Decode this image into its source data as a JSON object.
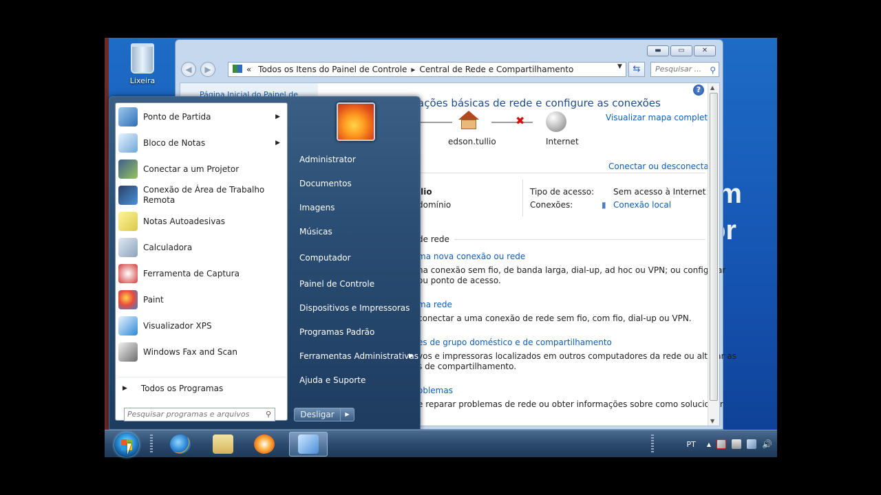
{
  "desktop": {
    "recycle_label": "Lixeira",
    "bg_text_1": "om",
    "bg_text_2": "or"
  },
  "window": {
    "controls": [
      "minimize-icon",
      "maximize-icon",
      "close-icon"
    ],
    "back_icon": "back-arrow-icon",
    "forward_icon": "forward-arrow-icon",
    "breadcrumb": {
      "root_icon": "control-panel-icon",
      "overflow": "«",
      "items": [
        "Todos os Itens do Painel de Controle",
        "Central de Rede e Compartilhamento"
      ]
    },
    "search_placeholder": "Pesquisar ...",
    "left_pane_link_partial": "Página Inicial do Painel de",
    "help_label": "?",
    "title": "ações básicas de rede e configure as conexões",
    "view_full_map": "Visualizar mapa completo",
    "network_map": {
      "node_computer": "edson.tullio",
      "node_internet": "Internet"
    },
    "connect_disconnect": "Conectar ou desconectar",
    "active_network": {
      "name_partial": "llio",
      "type_partial": "domínio",
      "access_type_label": "Tipo de acesso:",
      "access_type_value": "Sem acesso à Internet",
      "connections_label": "Conexões:",
      "connections_value": "Conexão local"
    },
    "section_header_partial": "de rede",
    "tasks": [
      {
        "link": "ma nova conexão ou rede",
        "desc1": "na conexão sem fio, de banda larga, dial-up, ad hoc ou VPN; ou configurar",
        "desc2": "ou ponto de acesso."
      },
      {
        "link": "ma rede",
        "desc1": "conectar a uma conexão de rede sem fio, com fio, dial-up ou VPN.",
        "desc2": ""
      },
      {
        "link": "es de grupo doméstico e de compartilhamento",
        "desc1": "vos e impressoras localizados em outros computadores da rede ou alterar as",
        "desc2": "s de compartilhamento."
      },
      {
        "link": "oblemas",
        "desc1": "e reparar problemas de rede ou obter informações sobre como solucionar",
        "desc2": ""
      }
    ]
  },
  "start_menu": {
    "programs": [
      {
        "label": "Ponto de Partida",
        "icon": "getting-started-icon",
        "submenu": true
      },
      {
        "label": "Bloco de Notas",
        "icon": "notepad-icon",
        "submenu": true
      },
      {
        "label": "Conectar a um Projetor",
        "icon": "projector-icon",
        "submenu": false
      },
      {
        "label": "Conexão de Área de Trabalho Remota",
        "icon": "remote-desktop-icon",
        "submenu": false
      },
      {
        "label": "Notas Autoadesivas",
        "icon": "sticky-notes-icon",
        "submenu": false
      },
      {
        "label": "Calculadora",
        "icon": "calculator-icon",
        "submenu": false
      },
      {
        "label": "Ferramenta de Captura",
        "icon": "snipping-tool-icon",
        "submenu": false
      },
      {
        "label": "Paint",
        "icon": "paint-icon",
        "submenu": false
      },
      {
        "label": "Visualizador XPS",
        "icon": "xps-viewer-icon",
        "submenu": false
      },
      {
        "label": "Windows Fax and Scan",
        "icon": "fax-scan-icon",
        "submenu": false
      }
    ],
    "all_programs": "Todos os Programas",
    "search_placeholder": "Pesquisar programas e arquivos",
    "right_items": [
      {
        "label": "Administrator",
        "submenu": false
      },
      {
        "label": "Documentos",
        "submenu": false
      },
      {
        "label": "Imagens",
        "submenu": false
      },
      {
        "label": "Músicas",
        "submenu": false
      },
      {
        "label": "Computador",
        "submenu": false
      },
      {
        "label": "Painel de Controle",
        "submenu": false
      },
      {
        "label": "Dispositivos e Impressoras",
        "submenu": false
      },
      {
        "label": "Programas Padrão",
        "submenu": false
      },
      {
        "label": "Ferramentas Administrativas",
        "submenu": true
      },
      {
        "label": "Ajuda e Suporte",
        "submenu": false
      }
    ],
    "shutdown": "Desligar"
  },
  "taskbar": {
    "apps": [
      "internet-explorer-icon",
      "explorer-folder-icon",
      "media-player-icon",
      "control-panel-icon"
    ],
    "language": "PT"
  }
}
